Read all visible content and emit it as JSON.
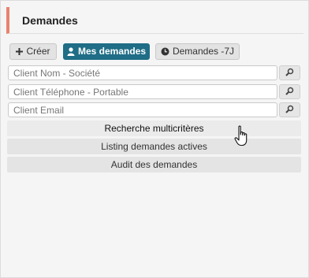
{
  "header": {
    "title": "Demandes"
  },
  "toolbar": {
    "create_label": "Créer",
    "my_requests_label": "Mes demandes",
    "recent_label": "Demandes -7J"
  },
  "search": {
    "client_name_placeholder": "Client Nom - Société",
    "client_phone_placeholder": "Client Téléphone - Portable",
    "client_email_placeholder": "Client Email"
  },
  "menu": {
    "multicriteria_label": "Recherche multicritères",
    "active_listing_label": "Listing demandes actives",
    "audit_label": "Audit des demandes"
  },
  "icons": {
    "create": "plus-icon",
    "my_requests": "user-icon",
    "recent": "clock-icon",
    "search": "magnifier-icon",
    "cursor": "hand-pointer-icon"
  },
  "colors": {
    "accent": "#e7836e",
    "primary_button": "#1f6d86"
  }
}
